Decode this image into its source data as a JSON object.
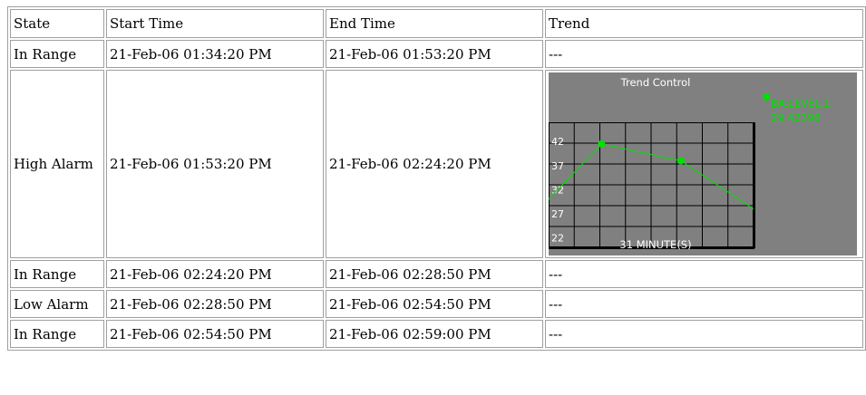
{
  "table": {
    "headers": [
      "State",
      "Start Time",
      "End Time",
      "Trend"
    ],
    "rows": [
      {
        "state": "In Range",
        "start": "21-Feb-06 01:34:20 PM",
        "end": "21-Feb-06 01:53:20 PM",
        "trend": "---"
      },
      {
        "state": "High Alarm",
        "start": "21-Feb-06 01:53:20 PM",
        "end": "21-Feb-06 02:24:20 PM",
        "trend": null
      },
      {
        "state": "In Range",
        "start": "21-Feb-06 02:24:20 PM",
        "end": "21-Feb-06 02:28:50 PM",
        "trend": "---"
      },
      {
        "state": "Low Alarm",
        "start": "21-Feb-06 02:28:50 PM",
        "end": "21-Feb-06 02:54:50 PM",
        "trend": "---"
      },
      {
        "state": "In Range",
        "start": "21-Feb-06 02:54:50 PM",
        "end": "21-Feb-06 02:59:00 PM",
        "trend": "---"
      }
    ]
  },
  "trend_control": {
    "title": "Trend Control",
    "footer": "31 MINUTE(S)",
    "legend_name": "BA:LEVEL.1",
    "legend_value": "29.42398",
    "line_color": "#00e000",
    "background_color": "#808080"
  },
  "chart_data": {
    "type": "line",
    "title": "Trend Control",
    "xlabel": "31 MINUTE(S)",
    "ylabel": "",
    "yticks": [
      42,
      37,
      32,
      27,
      22
    ],
    "ylim": [
      20,
      46
    ],
    "xlim": [
      0,
      31
    ],
    "series": [
      {
        "name": "BA:LEVEL.1",
        "x": [
          0,
          8,
          20,
          31
        ],
        "y": [
          30,
          41.5,
          38,
          28
        ],
        "markers": [
          false,
          true,
          true,
          false
        ]
      }
    ]
  }
}
